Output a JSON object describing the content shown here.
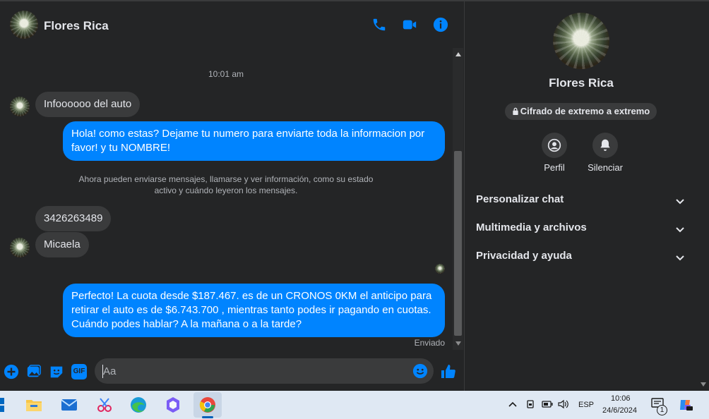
{
  "header": {
    "name": "Flores Rica"
  },
  "messages": {
    "timestamp": "10:01 am",
    "m1": "Infoooooo del auto",
    "m2": "Hola! como estas? Dejame tu numero para enviarte toda la informacion por favor! y tu NOMBRE!",
    "system": "Ahora pueden enviarse mensajes, llamarse y ver información, como su estado activo y cuándo leyeron los mensajes.",
    "m3": "3426263489",
    "m4": "Micaela",
    "m5": "Perfecto! La cuota desde $187.467. es de un CRONOS 0KM el anticipo para retirar el auto es de $6.743.700 , mientras tanto podes ir pagando en cuotas. Cuándo podes hablar? A la mañana o a la tarde?",
    "status": "Enviado"
  },
  "composer": {
    "placeholder": "Aa",
    "gif_label": "GIF"
  },
  "side": {
    "name": "Flores Rica",
    "encryption": "Cifrado de extremo a extremo",
    "actions": [
      "Perfil",
      "Silenciar"
    ],
    "sections": [
      "Personalizar chat",
      "Multimedia y archivos",
      "Privacidad y ayuda"
    ]
  },
  "taskbar": {
    "lang": "ESP",
    "time": "10:06",
    "date": "24/6/2024",
    "notif_count": "1"
  },
  "colors": {
    "accent": "#0084ff",
    "bg": "#242526",
    "bubble_in": "#3a3b3c"
  }
}
